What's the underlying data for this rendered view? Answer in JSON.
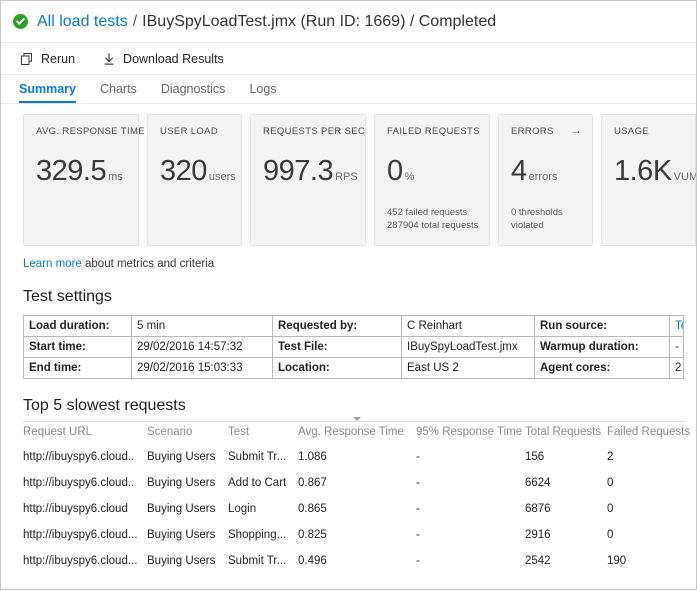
{
  "header": {
    "status_icon": "check-circle-icon",
    "status_color": "#2aa02a",
    "link_label": "All load tests",
    "separator": "/",
    "title_text": "IBuySpyLoadTest.jmx (Run ID: 1669) / Completed"
  },
  "toolbar": {
    "rerun_label": "Rerun",
    "rerun_icon": "rerun-icon",
    "download_label": "Download Results",
    "download_icon": "download-icon"
  },
  "tabs": [
    {
      "label": "Summary",
      "active": true
    },
    {
      "label": "Charts",
      "active": false
    },
    {
      "label": "Diagnostics",
      "active": false
    },
    {
      "label": "Logs",
      "active": false
    }
  ],
  "cards": [
    {
      "title": "AVG. RESPONSE TIME",
      "value": "329.5",
      "unit": "ms",
      "sub": "",
      "arrow": false
    },
    {
      "title": "USER LOAD",
      "value": "320",
      "unit": "users",
      "sub": "",
      "arrow": false
    },
    {
      "title": "REQUESTS PER SEC",
      "value": "997.3",
      "unit": "RPS",
      "sub": "",
      "arrow": false
    },
    {
      "title": "FAILED REQUESTS",
      "value": "0",
      "unit": "%",
      "sub": "452 failed requests\n287904 total requests",
      "arrow": false
    },
    {
      "title": "ERRORS",
      "value": "4",
      "unit": "errors",
      "sub": "0 thresholds violated",
      "arrow": true,
      "arrow_glyph": "→"
    },
    {
      "title": "USAGE",
      "value": "1.6K",
      "unit": "VUMs",
      "sub": "",
      "arrow": false
    }
  ],
  "learn": {
    "link_label": "Learn more",
    "rest_text": " about metrics and criteria"
  },
  "settings": {
    "heading": "Test settings",
    "rows": [
      {
        "label1": "Load duration:",
        "value1": "5 min",
        "label2": "Requested by:",
        "value2": "C Reinhart",
        "label3": "Run source:",
        "value3": "Team Services portal",
        "value3_is_link": true
      },
      {
        "label1": "Start time:",
        "value1": "29/02/2016 14:57:32",
        "label2": "Test File:",
        "value2": "IBuySpyLoadTest.jmx",
        "label3": "Warmup duration:",
        "value3": "-",
        "value3_is_link": false
      },
      {
        "label1": "End time:",
        "value1": "29/02/2016 15:03:33",
        "label2": "Location:",
        "value2": "East US 2",
        "label3": "Agent cores:",
        "value3": "2",
        "value3_is_link": false
      }
    ]
  },
  "requests": {
    "heading": "Top 5 slowest requests",
    "columns": [
      "Request URL",
      "Scenario",
      "Test",
      "Avg. Response Time",
      "95% Response Time",
      "Total Requests",
      "Failed Requests"
    ],
    "sorted_column_index": 3,
    "sort_direction": "desc",
    "rows": [
      {
        "url": "http://ibuyspy6.cloud..",
        "scenario": "Buying Users",
        "test": "Submit Tr...",
        "avg": "1.086",
        "p95": "-",
        "total": "156",
        "failed": "2"
      },
      {
        "url": "http://ibuyspy6.cloud..",
        "scenario": "Buying Users",
        "test": "Add to Cart",
        "avg": "0.867",
        "p95": "-",
        "total": "6624",
        "failed": "0"
      },
      {
        "url": "http://ibuyspy6.cloud",
        "scenario": "Buying Users",
        "test": "Login",
        "avg": "0.865",
        "p95": "-",
        "total": "6876",
        "failed": "0"
      },
      {
        "url": "http://ibuyspy6.cloud...",
        "scenario": "Buying Users",
        "test": "Shopping...",
        "avg": "0.825",
        "p95": "-",
        "total": "2916",
        "failed": "0"
      },
      {
        "url": "http://ibuyspy6.cloud...",
        "scenario": "Buying Users",
        "test": "Submit Tr...",
        "avg": "0.496",
        "p95": "-",
        "total": "2542",
        "failed": "190"
      }
    ]
  }
}
